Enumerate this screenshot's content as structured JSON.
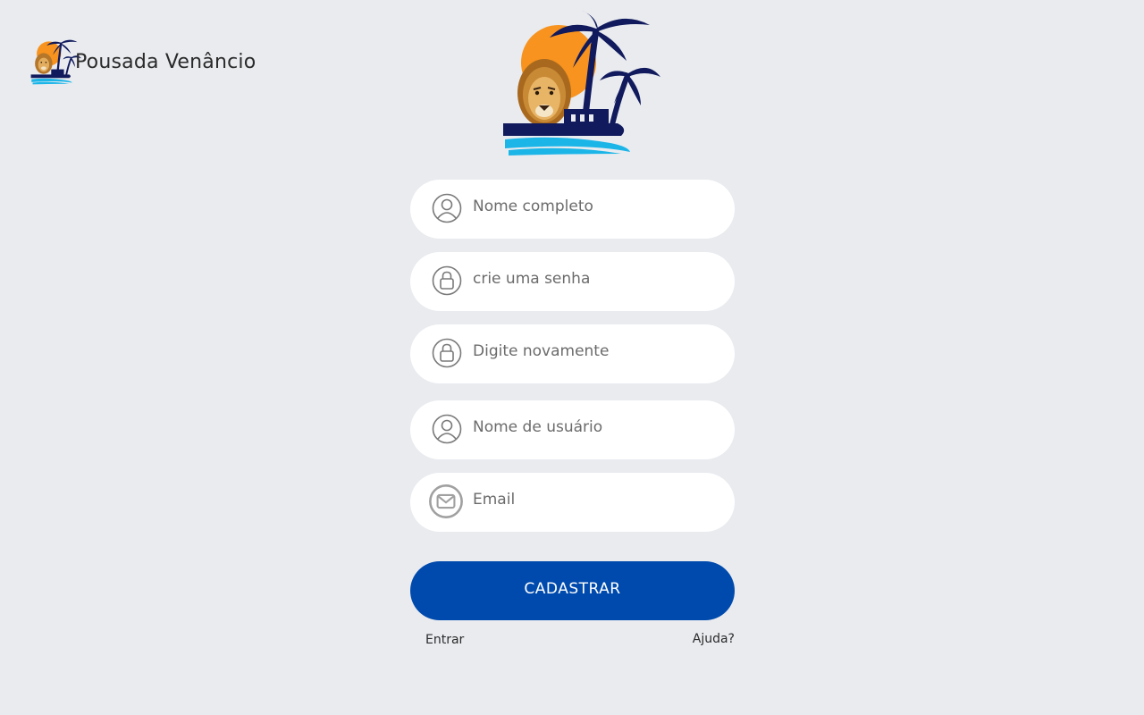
{
  "header": {
    "brand_name": "Pousada Venâncio",
    "logo_icon": "lion-palm-sunset-logo"
  },
  "hero": {
    "logo_icon": "lion-palm-sunset-logo"
  },
  "form": {
    "fields": [
      {
        "icon": "user-icon",
        "placeholder": "Nome completo",
        "value": ""
      },
      {
        "icon": "lock-icon",
        "placeholder": "crie uma senha",
        "value": ""
      },
      {
        "icon": "lock-icon",
        "placeholder": "Digite novamente",
        "value": ""
      },
      {
        "icon": "user-icon",
        "placeholder": "Nome de usuário",
        "value": ""
      },
      {
        "icon": "mail-icon",
        "placeholder": "Email",
        "value": ""
      }
    ],
    "submit_label": "CADASTRAR"
  },
  "links": {
    "login": "Entrar",
    "help": "Ajuda?"
  },
  "colors": {
    "background": "#e9ebef",
    "field_background": "#ffffff",
    "primary": "#004aad",
    "sun": "#f7931e",
    "palm": "#101a5c",
    "water": "#1cb5e8"
  }
}
